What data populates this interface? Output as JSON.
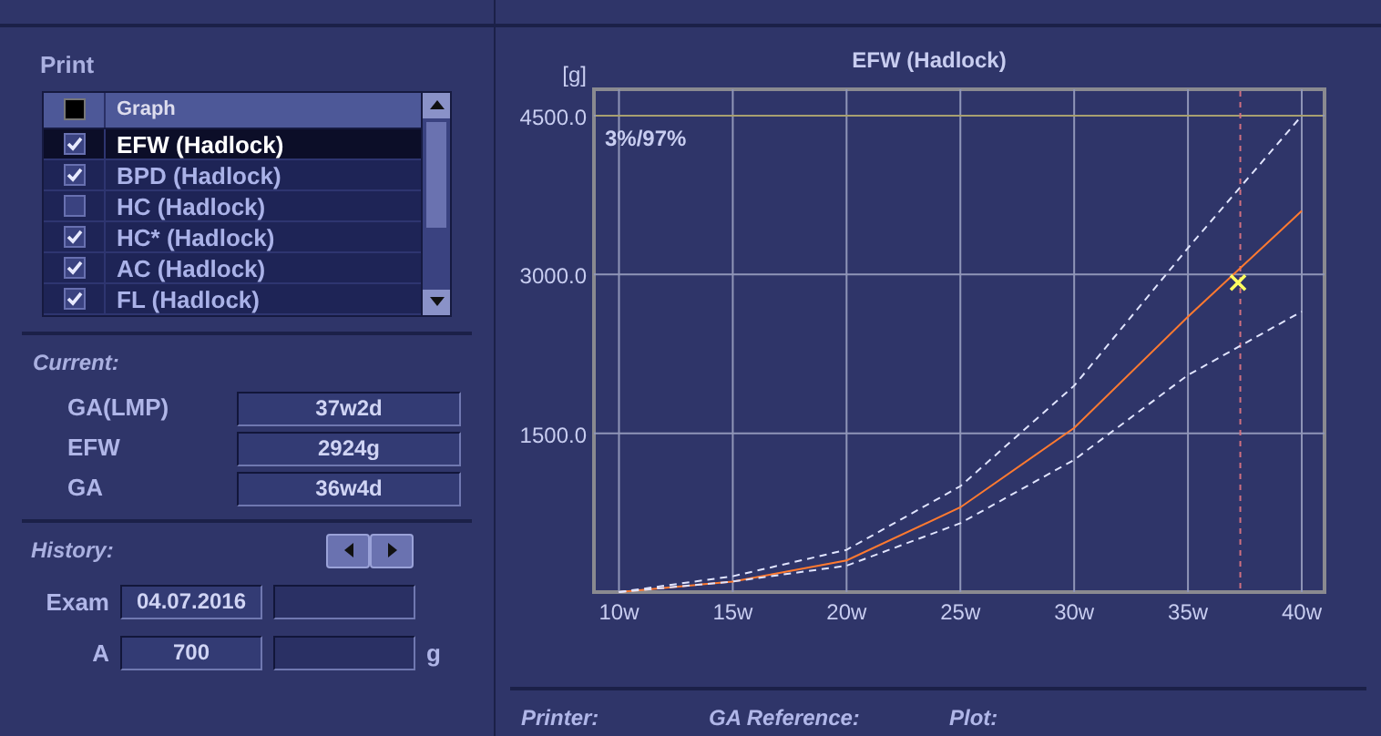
{
  "print": {
    "title": "Print",
    "header_checked": false,
    "column": "Graph",
    "rows": [
      {
        "label": "EFW (Hadlock)",
        "checked": true,
        "selected": true
      },
      {
        "label": "BPD (Hadlock)",
        "checked": true,
        "selected": false
      },
      {
        "label": "HC (Hadlock)",
        "checked": false,
        "selected": false
      },
      {
        "label": "HC* (Hadlock)",
        "checked": true,
        "selected": false
      },
      {
        "label": "AC (Hadlock)",
        "checked": true,
        "selected": false
      },
      {
        "label": "FL (Hadlock)",
        "checked": true,
        "selected": false
      }
    ]
  },
  "current": {
    "title": "Current:",
    "fields": [
      {
        "label": "GA(LMP)",
        "value": "37w2d"
      },
      {
        "label": "EFW",
        "value": "2924g"
      },
      {
        "label": "GA",
        "value": "36w4d"
      }
    ]
  },
  "history": {
    "title": "History:",
    "exam_label": "Exam",
    "exam_value": "04.07.2016",
    "a_label": "A",
    "a_value": "700",
    "unit": "g"
  },
  "chart": {
    "chart_data": {
      "type": "line",
      "title": "EFW (Hadlock)",
      "ylabel": "[g]",
      "x": [
        10,
        15,
        20,
        25,
        30,
        35,
        40
      ],
      "series": [
        {
          "color": "#ff7a30",
          "values": [
            0,
            100,
            300,
            800,
            1550,
            2600,
            3600
          ]
        },
        {
          "color": "#e0e4ff",
          "line_style": "dashed",
          "values": [
            0,
            150,
            400,
            1000,
            1950,
            3250,
            4500
          ]
        },
        {
          "color": "#e0e4ff",
          "line_style": "dashed",
          "values": [
            0,
            100,
            250,
            650,
            1250,
            2050,
            2650
          ]
        }
      ],
      "grid": true,
      "ref_lines": [
        {
          "axis": "y",
          "value": 4500
        },
        {
          "axis": "x",
          "value": 37.3
        }
      ],
      "xlim": [
        8.9,
        41
      ],
      "ylim": [
        0,
        4750
      ],
      "xticks": [
        {
          "value": 10,
          "label": "10w"
        },
        {
          "value": 15,
          "label": "15w"
        },
        {
          "value": 20,
          "label": "20w"
        },
        {
          "value": 25,
          "label": "25w"
        },
        {
          "value": 30,
          "label": "30w"
        },
        {
          "value": 35,
          "label": "35w"
        },
        {
          "value": 40,
          "label": "40w"
        }
      ],
      "yticks": [
        {
          "value": 1500,
          "label": "1500.0"
        },
        {
          "value": 3000,
          "label": "3000.0"
        },
        {
          "value": 4500,
          "label": "4500.0"
        }
      ],
      "annotations": [
        {
          "text": "3%/97%"
        }
      ]
    }
  },
  "footer": {
    "labels": [
      "Printer:",
      "GA Reference:",
      "Plot:"
    ]
  }
}
